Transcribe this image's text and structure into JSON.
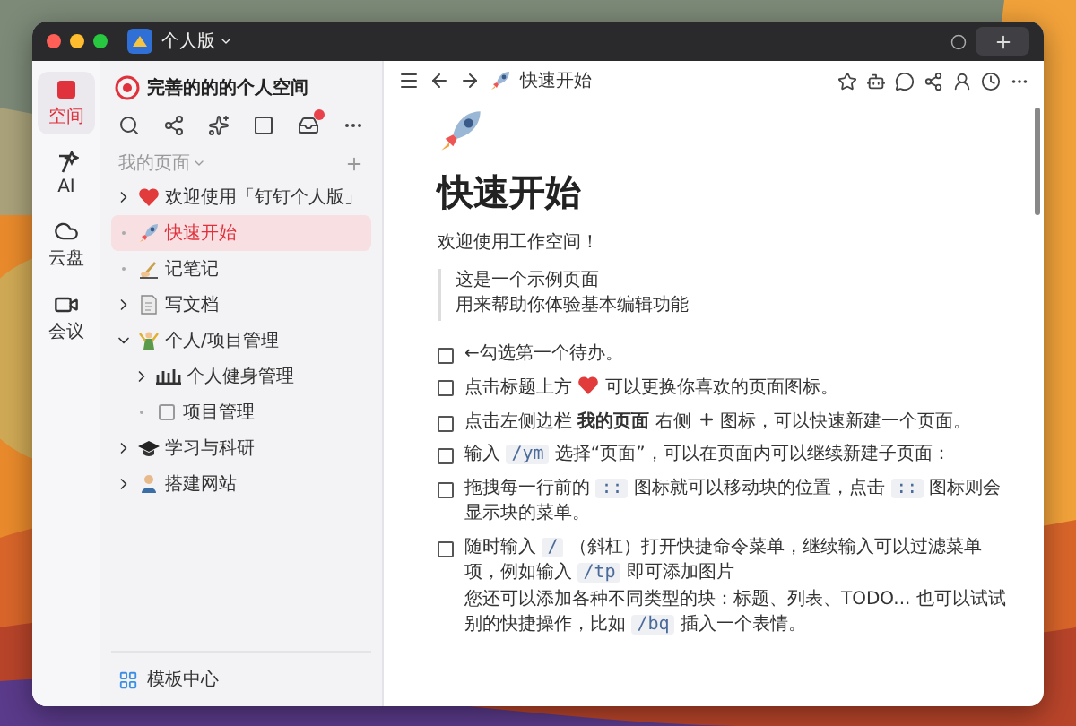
{
  "titlebar": {
    "app_label": "个人版"
  },
  "rail": [
    {
      "label": "空间",
      "selected": true
    },
    {
      "label": "AI",
      "selected": false
    },
    {
      "label": "云盘",
      "selected": false
    },
    {
      "label": "会议",
      "selected": false
    }
  ],
  "sidebar": {
    "space_name": "完善的的的个人空间",
    "section_label": "我的页面",
    "footer": "模板中心",
    "tree": [
      {
        "label": "欢迎使用「钉钉个人版」",
        "expanded": false,
        "selected": false
      },
      {
        "label": "快速开始",
        "selected": true
      },
      {
        "label": "记笔记",
        "selected": false
      },
      {
        "label": "写文档",
        "expanded": false,
        "selected": false
      },
      {
        "label": "个人/项目管理",
        "expanded": true,
        "selected": false,
        "children": [
          {
            "label": "个人健身管理",
            "expanded": false,
            "selected": false
          },
          {
            "label": "项目管理",
            "selected": false
          }
        ]
      },
      {
        "label": "学习与科研",
        "expanded": false,
        "selected": false
      },
      {
        "label": "搭建网站",
        "expanded": false,
        "selected": false
      }
    ]
  },
  "page": {
    "breadcrumb": "快速开始",
    "title": "快速开始",
    "welcome": "欢迎使用工作空间！",
    "quote": [
      "这是一个示例页面",
      "用来帮助你体验基本编辑功能"
    ],
    "todos": [
      {
        "checked": false,
        "segments": [
          {
            "kind": "text",
            "text": "←勾选第一个待办。"
          }
        ]
      },
      {
        "checked": false,
        "segments": [
          {
            "kind": "text",
            "text": "点击标题上方 "
          },
          {
            "kind": "heart"
          },
          {
            "kind": "text",
            "text": " 可以更换你喜欢的页面图标。"
          }
        ]
      },
      {
        "checked": false,
        "segments": [
          {
            "kind": "text",
            "text": "点击左侧边栏 **我的页面** 右侧 "
          },
          {
            "kind": "plus"
          },
          {
            "kind": "text",
            "text": " 图标，可以快速新建一个页面。"
          }
        ]
      },
      {
        "checked": false,
        "segments": [
          {
            "kind": "text",
            "text": "输入 "
          },
          {
            "kind": "code",
            "text": "/ym"
          },
          {
            "kind": "text",
            "text": " 选择“页面”，可以在页面内可以继续新建子页面："
          }
        ]
      },
      {
        "checked": false,
        "segments": [
          {
            "kind": "text",
            "text": "拖拽每一行前的 "
          },
          {
            "kind": "code",
            "text": "::"
          },
          {
            "kind": "text",
            "text": " 图标就可以移动块的位置，点击 "
          },
          {
            "kind": "code",
            "text": "::"
          },
          {
            "kind": "text",
            "text": " 图标则会显示块的菜单。"
          }
        ]
      },
      {
        "checked": false,
        "segments": [
          {
            "kind": "text",
            "text": "随时输入 "
          },
          {
            "kind": "code",
            "text": "/"
          },
          {
            "kind": "text",
            "text": " （斜杠）打开快捷命令菜单，继续输入可以过滤菜单项，例如输入 "
          },
          {
            "kind": "code",
            "text": "/tp"
          },
          {
            "kind": "text",
            "text": " 即可添加图片"
          }
        ],
        "note": [
          {
            "kind": "text",
            "text": "您还可以添加各种不同类型的块：标题、列表、TODO... 也可以试试别的快捷操作，比如 "
          },
          {
            "kind": "code",
            "text": "/bq"
          },
          {
            "kind": "text",
            "text": " 插入一个表情。"
          }
        ]
      }
    ]
  }
}
